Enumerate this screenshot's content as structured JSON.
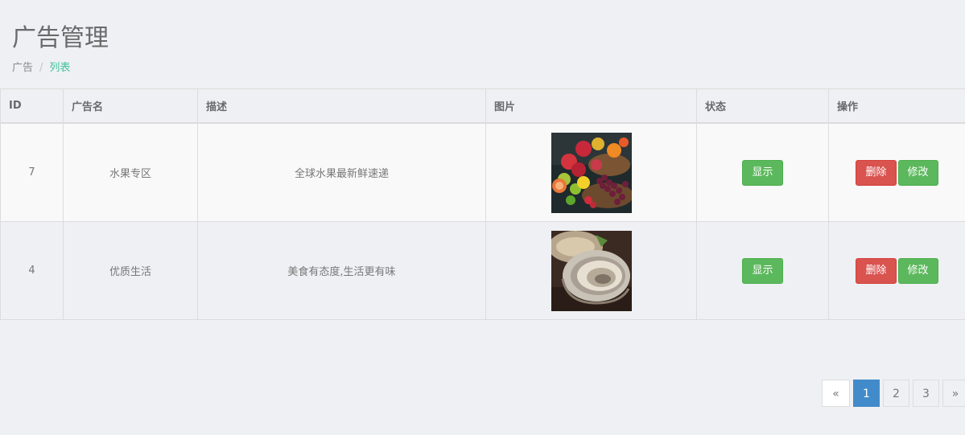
{
  "page": {
    "title": "广告管理"
  },
  "breadcrumb": {
    "root": "广告",
    "separator": "/",
    "current": "列表"
  },
  "table": {
    "headers": [
      "ID",
      "广告名",
      "描述",
      "图片",
      "状态",
      "操作"
    ],
    "rows": [
      {
        "id": "7",
        "name": "水果专区",
        "description": "全球水果最新鲜速递",
        "image": "fruit-basket-image",
        "status_label": "显示",
        "delete_label": "删除",
        "edit_label": "修改"
      },
      {
        "id": "4",
        "name": "优质生活",
        "description": "美食有态度,生活更有味",
        "image": "oyster-image",
        "status_label": "显示",
        "delete_label": "删除",
        "edit_label": "修改"
      }
    ]
  },
  "pagination": {
    "prev": "«",
    "pages": [
      "1",
      "2",
      "3"
    ],
    "active_page": "1",
    "next": "»"
  },
  "colors": {
    "background": "#eff0f4",
    "accent_green": "#5cb85c",
    "danger_red": "#d9534f",
    "primary_blue": "#428bca",
    "breadcrumb_active": "#3fc19a"
  }
}
